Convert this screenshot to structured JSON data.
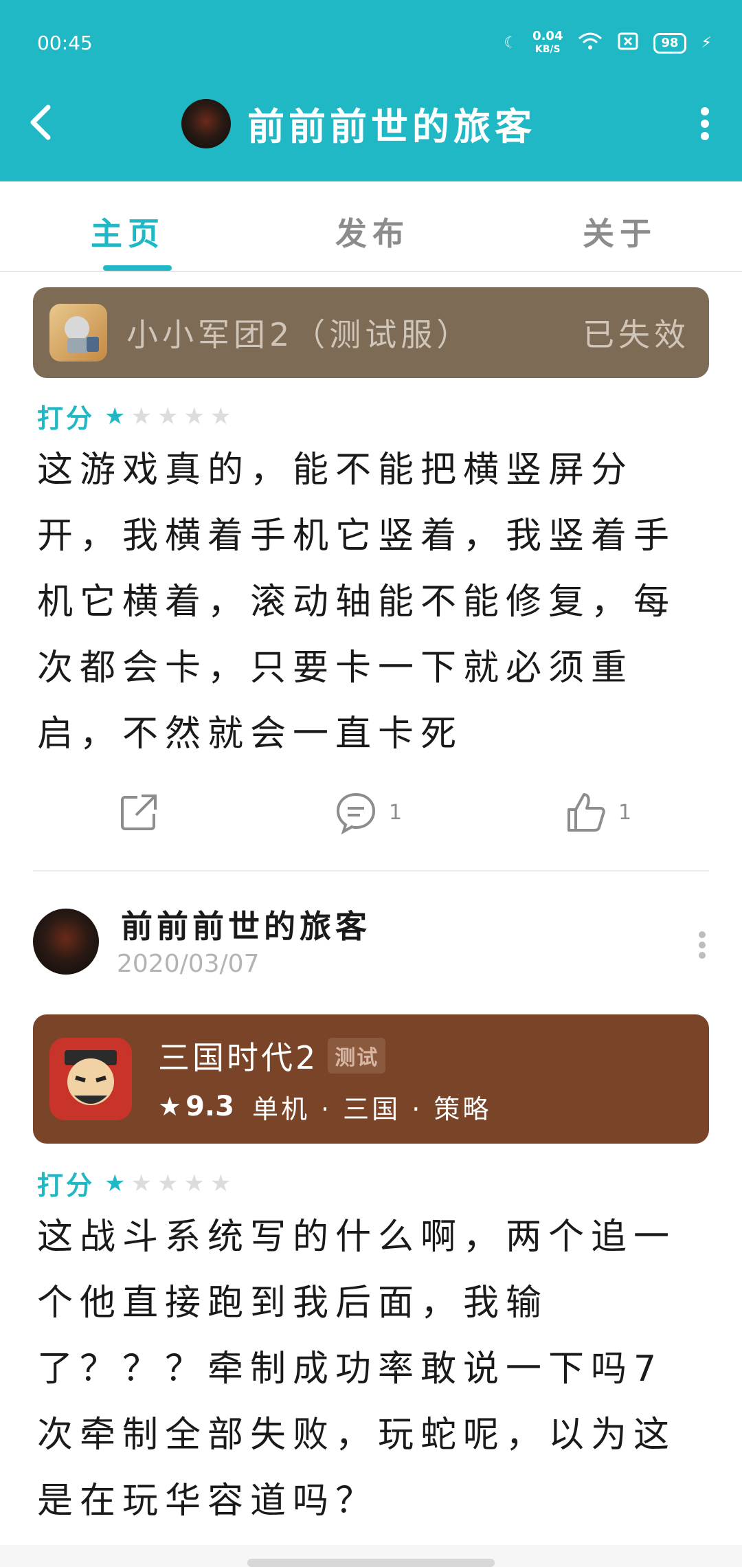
{
  "status_bar": {
    "time": "00:45",
    "speed": "0.04",
    "speed_unit": "KB/S",
    "battery": "98"
  },
  "header": {
    "title": "前前前世的旅客"
  },
  "tabs": [
    {
      "label": "主页"
    },
    {
      "label": "发布"
    },
    {
      "label": "关于"
    }
  ],
  "post1": {
    "game": {
      "name": "小小军团2（测试服）",
      "status": "已失效"
    },
    "rating": {
      "label": "打分",
      "stars": 1,
      "max": 5
    },
    "text": "这游戏真的，能不能把横竖屏分开，我横着手机它竖着，我竖着手机它横着，滚动轴能不能修复，每次都会卡，只要卡一下就必须重启，不然就会一直卡死",
    "actions": {
      "comment_count": "1",
      "like_count": "1"
    }
  },
  "post2": {
    "author": {
      "name": "前前前世的旅客",
      "date": "2020/03/07"
    },
    "game": {
      "name": "三国时代2",
      "badge": "测试",
      "score": "9.3",
      "tags": "单机 · 三国 · 策略"
    },
    "rating": {
      "label": "打分",
      "stars": 1,
      "max": 5
    },
    "text": "这战斗系统写的什么啊，两个追一个他直接跑到我后面，我输了？？？牵制成功率敢说一下吗7次牵制全部失败，玩蛇呢，以为这是在玩华容道吗？"
  },
  "colors": {
    "accent": "#1fb8c4",
    "card1_bg": "#7e6b55",
    "card2_bg": "#7a4428"
  }
}
